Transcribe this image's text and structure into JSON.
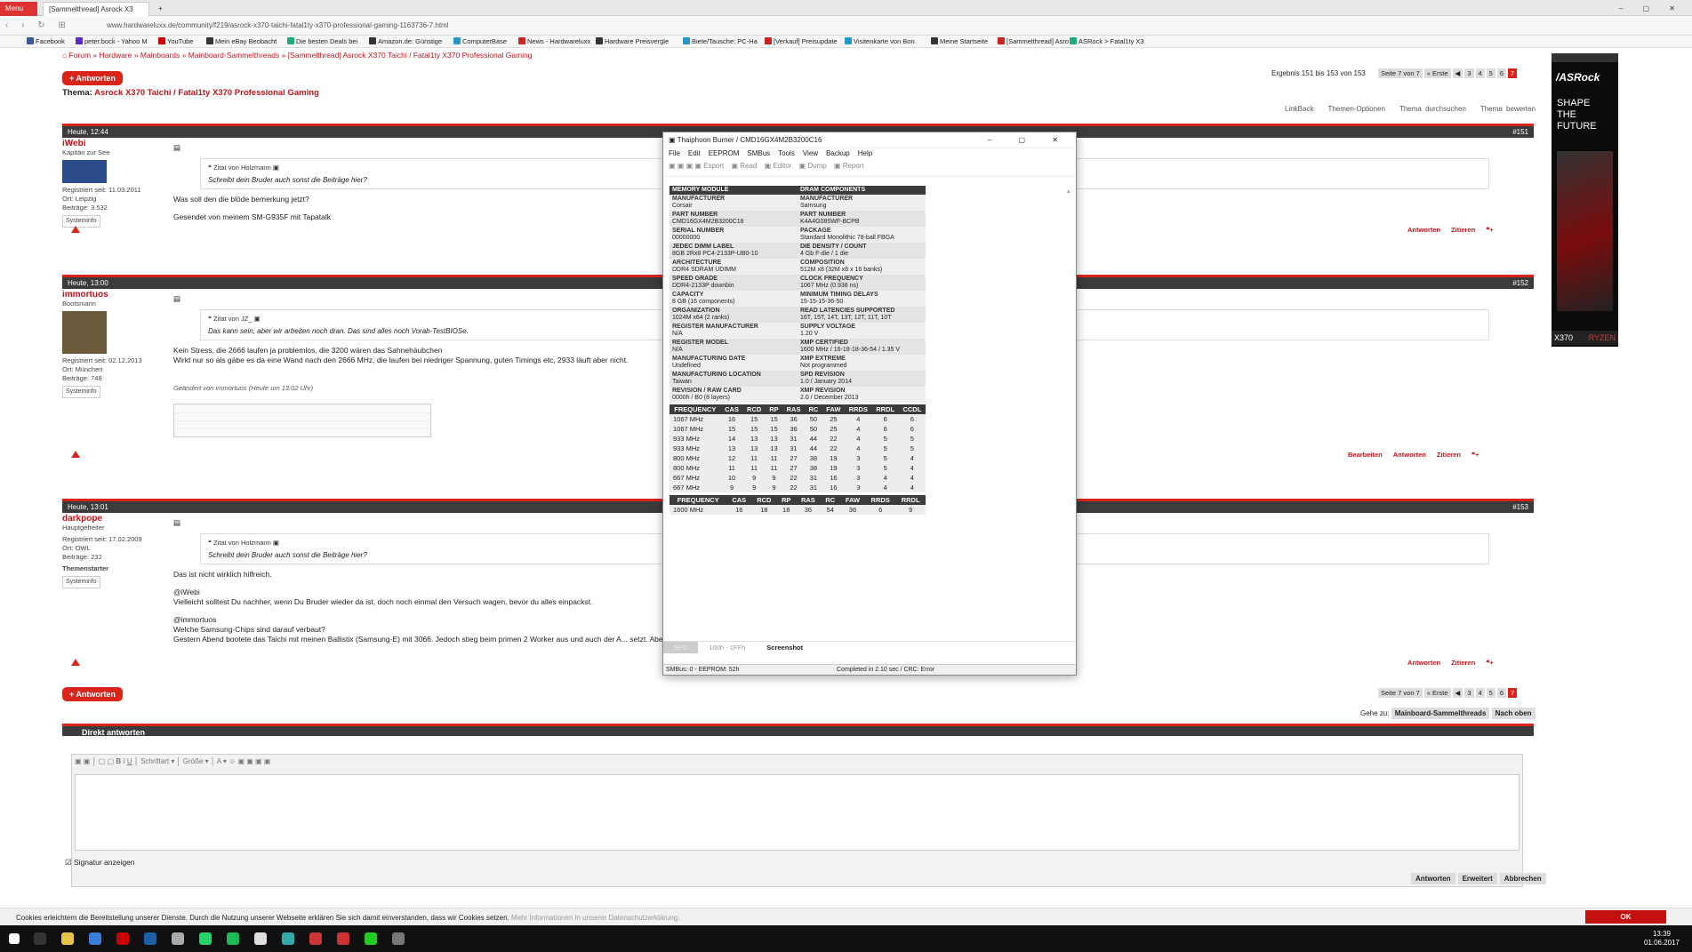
{
  "browser": {
    "menu": "Menu",
    "tab_title": "[Sammelthread] Asrock X3",
    "url": "www.hardwareluxx.de/community/f219/asrock-x370-taichi-fatal1ty-x370-professional-gaming-1163736-7.html"
  },
  "bookmarks": [
    "Facebook",
    "peter.bock - Yahoo M",
    "YouTube",
    "Mein eBay Beobacht",
    "Die besten Deals bei",
    "Amazon.de: Günstige",
    "ComputerBase",
    "News - Hardwareluxx",
    "Hardware Preisvergle",
    "Biete/Tausche: PC-Ha",
    "[Verkauf] Preisupdate",
    "Visitenkarte von Bon",
    "Meine Startseite",
    "[Sammelthread] Asro",
    "ASRock > Fatal1ty X3"
  ],
  "breadcrumb": [
    "Forum",
    "Hardware",
    "Mainboards",
    "Mainboard-Sammelthreads",
    "[Sammelthread] Asrock X370 Taichi / Fatal1ty X370 Professional Gaming"
  ],
  "reply_label": "+ Antworten",
  "thema_label": "Thema:",
  "thema_title": "Asrock X370 Taichi / Fatal1ty X370 Professional Gaming",
  "result_text": "Ergebnis 151 bis 153 von 153",
  "pager": {
    "page_label": "Seite 7 von 7",
    "first": "« Erste",
    "pages": [
      "3",
      "4",
      "5",
      "6",
      "7"
    ]
  },
  "thread_tools": [
    "LinkBack",
    "Themen-Optionen",
    "Thema durchsuchen",
    "Thema bewerten"
  ],
  "posts": [
    {
      "date": "Heute, 12:44",
      "num": "#151",
      "user": "iWebi",
      "rank": "Kapitän zur See",
      "reg": "Registriert seit: 11.03.2011",
      "ort": "Ort: Leipzig",
      "beitr": "Beiträge: 3.532",
      "sys": "Systeminfo",
      "quote_head": "Zitat von Holzmann",
      "quote": "Schreibt dein Bruder auch sonst die Beiträge hier?",
      "lines": [
        "Was soll den die blöde bemerkung jetzt?",
        "",
        "Gesendet von meinem SM-G935F mit Tapatalk"
      ]
    },
    {
      "date": "Heute, 13:00",
      "num": "#152",
      "user": "immortuos",
      "rank": "Bootsmann",
      "reg": "Registriert seit: 02.12.2013",
      "ort": "Ort: München",
      "beitr": "Beiträge: 748",
      "sys": "Systeminfo",
      "quote_head": "Zitat von JZ_",
      "quote": "Das kann sein, aber wir arbeiten noch dran. Das sind alles noch Vorab-TestBIOSe.",
      "lines": [
        "Kein Stress, die 2666 laufen ja problemlos, die 3200 wären das Sahnehäubchen",
        "Wirkt nur so als gäbe es da eine Wand nach den 2666 MHz, die laufen bei niedriger Spannung, guten Timings etc, 2933 läuft aber nicht."
      ],
      "edited": "Geändert von immortuos (Heute um 13:02 Uhr)"
    },
    {
      "date": "Heute, 13:01",
      "num": "#153",
      "user": "darkpope",
      "rank": "Hauptgefreiter",
      "reg": "Registriert seit: 17.02.2009",
      "ort": "Ort: OWL",
      "beitr": "Beiträge: 232",
      "starter": "Themenstarter",
      "sys": "Systeminfo",
      "quote_head": "Zitat von Holzmann",
      "quote": "Schreibt dein Bruder auch sonst die Beiträge hier?",
      "lines": [
        "Das ist nicht wirklich hilfreich.",
        "",
        "@iWebi",
        "Vielleicht solltest Du nachher, wenn Du Bruder wieder da ist, doch noch einmal den Versuch wagen, bevor du alles einpackst.",
        "",
        "@immortuos",
        "Welche Samsung-Chips sind darauf verbaut?",
        "Gestern Abend bootete das Taichi mit meinen Ballistix (Samsung-E) mit 3066. Jedoch stieg beim primen 2 Worker aus und auch der A... setzt. Aber ich teste wahrscheinlich heute Abend weiter."
      ]
    }
  ],
  "post_actions": {
    "edit": "Bearbeiten",
    "reply": "Antworten",
    "quote": "Zitieren"
  },
  "goto": {
    "label": "Gehe zu:",
    "target": "Mainboard-Sammelthreads",
    "top": "Nach oben"
  },
  "direct_reply": "Direkt antworten",
  "editor": {
    "font": "Schriftart",
    "size": "Größe"
  },
  "signature": "Signatur anzeigen",
  "form_buttons": [
    "Antworten",
    "Erweitert",
    "Abbrechen"
  ],
  "cookie": {
    "text": "Cookies erleichtern die Bereitstellung unserer Dienste. Durch die Nutzung unserer Webseite erklären Sie sich damit einverstanden, dass wir Cookies setzen.",
    "link": "Mehr Informationen in unserer Datenschutzerklärung.",
    "ok": "OK"
  },
  "ad": {
    "brand": "/ASRock",
    "slogan": [
      "SHAPE",
      "THE",
      "FUTURE"
    ],
    "model": "X370",
    "cpu": "RYZEN"
  },
  "tb": {
    "title": "Thaiphoon Burner / CMD16GX4M2B3200C16",
    "menu": [
      "File",
      "Edit",
      "EEPROM",
      "SMBus",
      "Tools",
      "View",
      "Backup",
      "Help"
    ],
    "toolbar": [
      "Export",
      "Read",
      "Editor",
      "Dump",
      "Report"
    ],
    "h_left": "MEMORY MODULE",
    "h_right": "DRAM COMPONENTS",
    "rows": [
      [
        "MANUFACTURER",
        "Corsair",
        "MANUFACTURER",
        "Samsung"
      ],
      [
        "PART NUMBER",
        "CMD16GX4M2B3200C16",
        "PART NUMBER",
        "K4A4G085WF-BCPB"
      ],
      [
        "SERIAL NUMBER",
        "00000000",
        "PACKAGE",
        "Standard Monolithic 78-ball FBGA"
      ],
      [
        "JEDEC DIMM LABEL",
        "8GB 2Rx8 PC4-2133P-UB0-10",
        "DIE DENSITY / COUNT",
        "4 Gb F-die / 1 die"
      ],
      [
        "ARCHITECTURE",
        "DDR4 SDRAM UDIMM",
        "COMPOSITION",
        "512M x8 (32M x8 x 16 banks)"
      ],
      [
        "SPEED GRADE",
        "DDR4-2133P downbin",
        "CLOCK FREQUENCY",
        "1067 MHz (0.938 ns)"
      ],
      [
        "CAPACITY",
        "8 GB (16 components)",
        "MINIMUM TIMING DELAYS",
        "15-15-15-36-50"
      ],
      [
        "ORGANIZATION",
        "1024M x64 (2 ranks)",
        "READ LATENCIES SUPPORTED",
        "16T, 15T, 14T, 13T, 12T, 11T, 10T"
      ],
      [
        "REGISTER MANUFACTURER",
        "N/A",
        "SUPPLY VOLTAGE",
        "1.20 V"
      ],
      [
        "REGISTER MODEL",
        "N/A",
        "XMP CERTIFIED",
        "1600 MHz / 16-18-18-36-54 / 1.35 V"
      ],
      [
        "MANUFACTURING DATE",
        "Undefined",
        "XMP EXTREME",
        "Not programmed"
      ],
      [
        "MANUFACTURING LOCATION",
        "Taiwan",
        "SPD REVISION",
        "1.0 / January 2014"
      ],
      [
        "REVISION / RAW CARD",
        "0000h / B0 (8 layers)",
        "XMP REVISION",
        "2.0 / December 2013"
      ]
    ],
    "fcols": [
      "FREQUENCY",
      "CAS",
      "RCD",
      "RP",
      "RAS",
      "RC",
      "FAW",
      "RRDS",
      "RRDL",
      "CCDL"
    ],
    "frows": [
      [
        "1067 MHz",
        "16",
        "15",
        "15",
        "36",
        "50",
        "25",
        "4",
        "6",
        "6"
      ],
      [
        "1067 MHz",
        "15",
        "15",
        "15",
        "36",
        "50",
        "25",
        "4",
        "6",
        "6"
      ],
      [
        "933 MHz",
        "14",
        "13",
        "13",
        "31",
        "44",
        "22",
        "4",
        "5",
        "5"
      ],
      [
        "933 MHz",
        "13",
        "13",
        "13",
        "31",
        "44",
        "22",
        "4",
        "5",
        "5"
      ],
      [
        "800 MHz",
        "12",
        "11",
        "11",
        "27",
        "38",
        "19",
        "3",
        "5",
        "4"
      ],
      [
        "800 MHz",
        "11",
        "11",
        "11",
        "27",
        "38",
        "19",
        "3",
        "5",
        "4"
      ],
      [
        "667 MHz",
        "10",
        "9",
        "9",
        "22",
        "31",
        "16",
        "3",
        "4",
        "4"
      ],
      [
        "667 MHz",
        "9",
        "9",
        "9",
        "22",
        "31",
        "16",
        "3",
        "4",
        "4"
      ]
    ],
    "xcols": [
      "FREQUENCY",
      "CAS",
      "RCD",
      "RP",
      "RAS",
      "RC",
      "FAW",
      "RRDS",
      "RRDL"
    ],
    "xrow": [
      "1600 MHz",
      "16",
      "18",
      "18",
      "36",
      "54",
      "36",
      "6",
      "9"
    ],
    "tabs": [
      "SPD",
      "100h - 1FFh",
      "Screenshot"
    ],
    "status_left": "SMBus: 0 - EEPROM: 52h",
    "status_right": "Completed in 2.10 sec / CRC: Error"
  },
  "clock": {
    "time": "13:39",
    "date": "01.06.2017"
  }
}
